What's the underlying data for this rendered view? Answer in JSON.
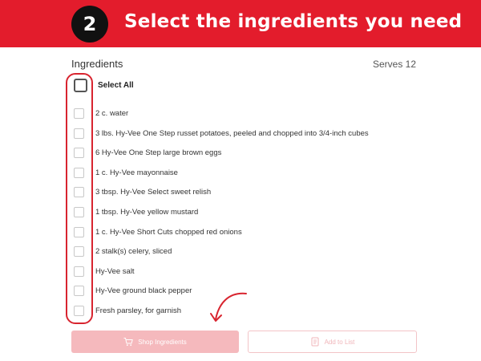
{
  "banner": {
    "step_number": "2",
    "title": "Select the ingredients you need",
    "color": "#e31c2c"
  },
  "header": {
    "ingredients_label": "Ingredients",
    "serves": "Serves 12"
  },
  "select_all": {
    "label": "Select All",
    "checked": false
  },
  "ingredients": [
    {
      "label": "2 c. water",
      "checked": false
    },
    {
      "label": "3 lbs. Hy-Vee One Step russet potatoes, peeled and chopped into 3/4-inch cubes",
      "checked": false
    },
    {
      "label": "6 Hy-Vee One Step large brown eggs",
      "checked": false
    },
    {
      "label": "1 c. Hy-Vee mayonnaise",
      "checked": false
    },
    {
      "label": "3 tbsp. Hy-Vee Select sweet relish",
      "checked": false
    },
    {
      "label": "1 tbsp. Hy-Vee yellow mustard",
      "checked": false
    },
    {
      "label": "1 c. Hy-Vee Short Cuts chopped red onions",
      "checked": false
    },
    {
      "label": "2 stalk(s) celery, sliced",
      "checked": false
    },
    {
      "label": "Hy-Vee salt",
      "checked": false
    },
    {
      "label": "Hy-Vee ground black pepper",
      "checked": false
    },
    {
      "label": "Fresh parsley, for garnish",
      "checked": false
    }
  ],
  "buttons": {
    "shop_label": "Shop Ingredients",
    "shop_icon": "cart-icon",
    "add_list_label": "Add to List",
    "add_list_icon": "list-icon"
  }
}
